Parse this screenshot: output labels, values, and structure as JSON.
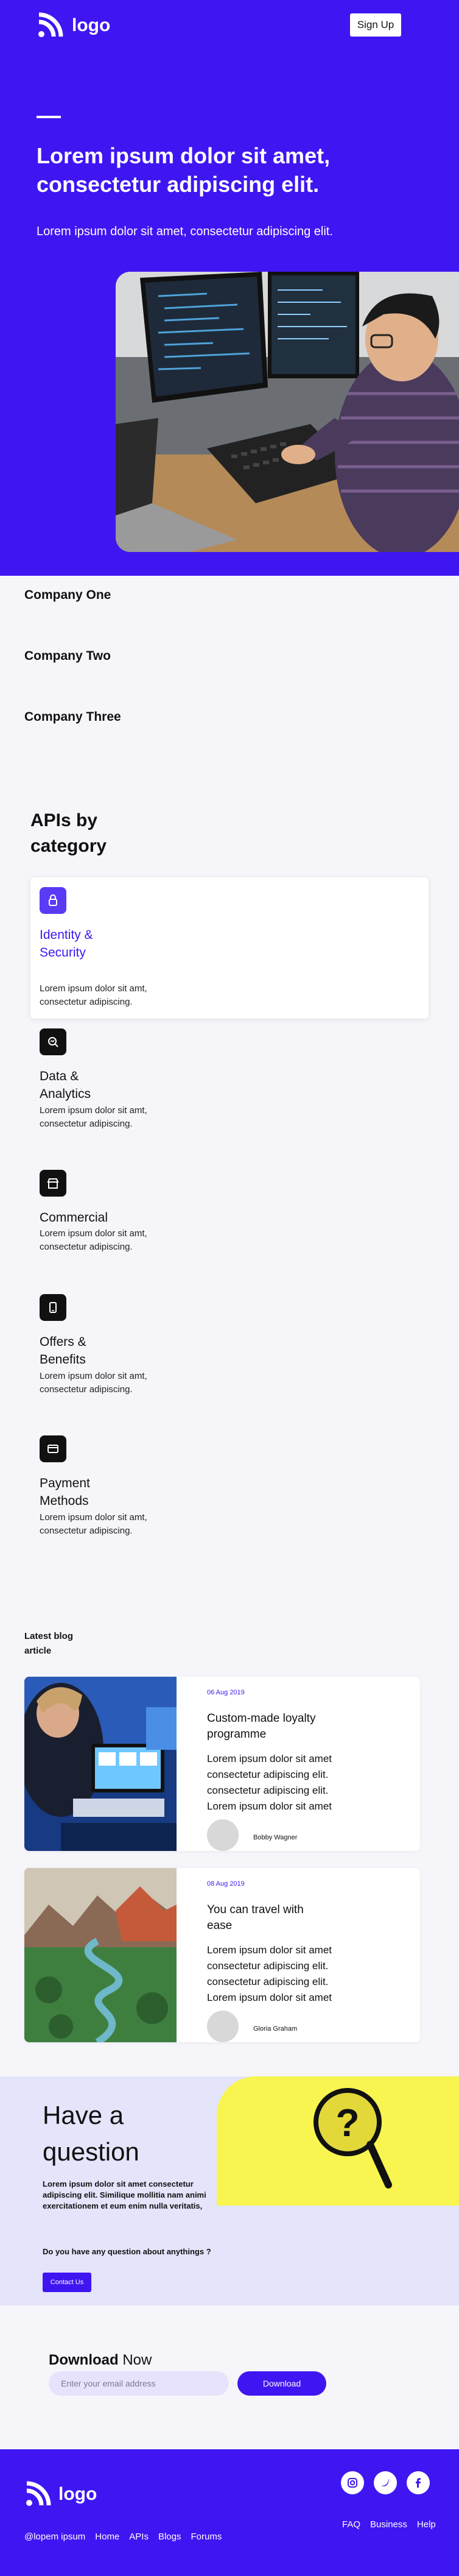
{
  "header": {
    "logo_text": "logo",
    "signup_label": "Sign Up"
  },
  "hero": {
    "title": "Lorem ipsum dolor sit amet, consectetur adipiscing elit.",
    "subtitle": "Lorem ipsum dolor sit amet, consectetur adipiscing elit."
  },
  "companies": [
    "Company One",
    "Company Two",
    "Company Three"
  ],
  "apis": {
    "title": "APIs by category",
    "items": [
      {
        "name": "Identity & Security",
        "desc": "Lorem ipsum dolor sit amt, consectetur adipiscing.",
        "icon": "lock-icon"
      },
      {
        "name": "Data & Analytics",
        "desc": "Lorem ipsum dolor sit amt, consectetur adipiscing.",
        "icon": "magnifier-chart-icon"
      },
      {
        "name": "Commercial",
        "desc": "Lorem ipsum dolor sit amt, consectetur adipiscing.",
        "icon": "shop-icon"
      },
      {
        "name": "Offers & Benefits",
        "desc": "Lorem ipsum dolor sit amt, consectetur adipiscing.",
        "icon": "mobile-offer-icon"
      },
      {
        "name": "Payment Methods",
        "desc": "Lorem ipsum dolor sit amt, consectetur adipiscing.",
        "icon": "card-icon"
      }
    ]
  },
  "blog": {
    "heading": "Latest blog article",
    "articles": [
      {
        "date": "06 Aug 2019",
        "title": "Custom-made loyalty programme",
        "body": "Lorem ipsum dolor sit amet consectetur adipiscing elit. consectetur adipiscing elit. Lorem ipsum dolor sit amet",
        "author": "Bobby Wagner"
      },
      {
        "date": "08 Aug 2019",
        "title": "You can travel with ease",
        "body": "Lorem ipsum dolor sit amet consectetur adipiscing elit. consectetur adipiscing elit. Lorem ipsum dolor sit amet",
        "author": "Gloria Graham"
      }
    ]
  },
  "question": {
    "title": "Have a question",
    "body": "Lorem ipsum dolor sit amet consectetur adipiscing elit. Similique mollitia nam animi exercitationem et eum enim nulla veritatis,",
    "ask": "Do you have any question about anythings ?",
    "button": "Contact Us"
  },
  "download": {
    "title_bold": "Download",
    "title_rest": " Now",
    "placeholder": "Enter your email address",
    "button": "Download"
  },
  "footer": {
    "logo_text": "logo",
    "copyright": "@lopem ipsum",
    "links_left": [
      "Home",
      "APIs",
      "Blogs",
      "Forums"
    ],
    "links_right": [
      "FAQ",
      "Business",
      "Help"
    ],
    "social": [
      "instagram-icon",
      "twitter-icon",
      "facebook-icon"
    ]
  },
  "colors": {
    "brand": "#3f16f2",
    "accent_yellow": "#f8f550"
  }
}
